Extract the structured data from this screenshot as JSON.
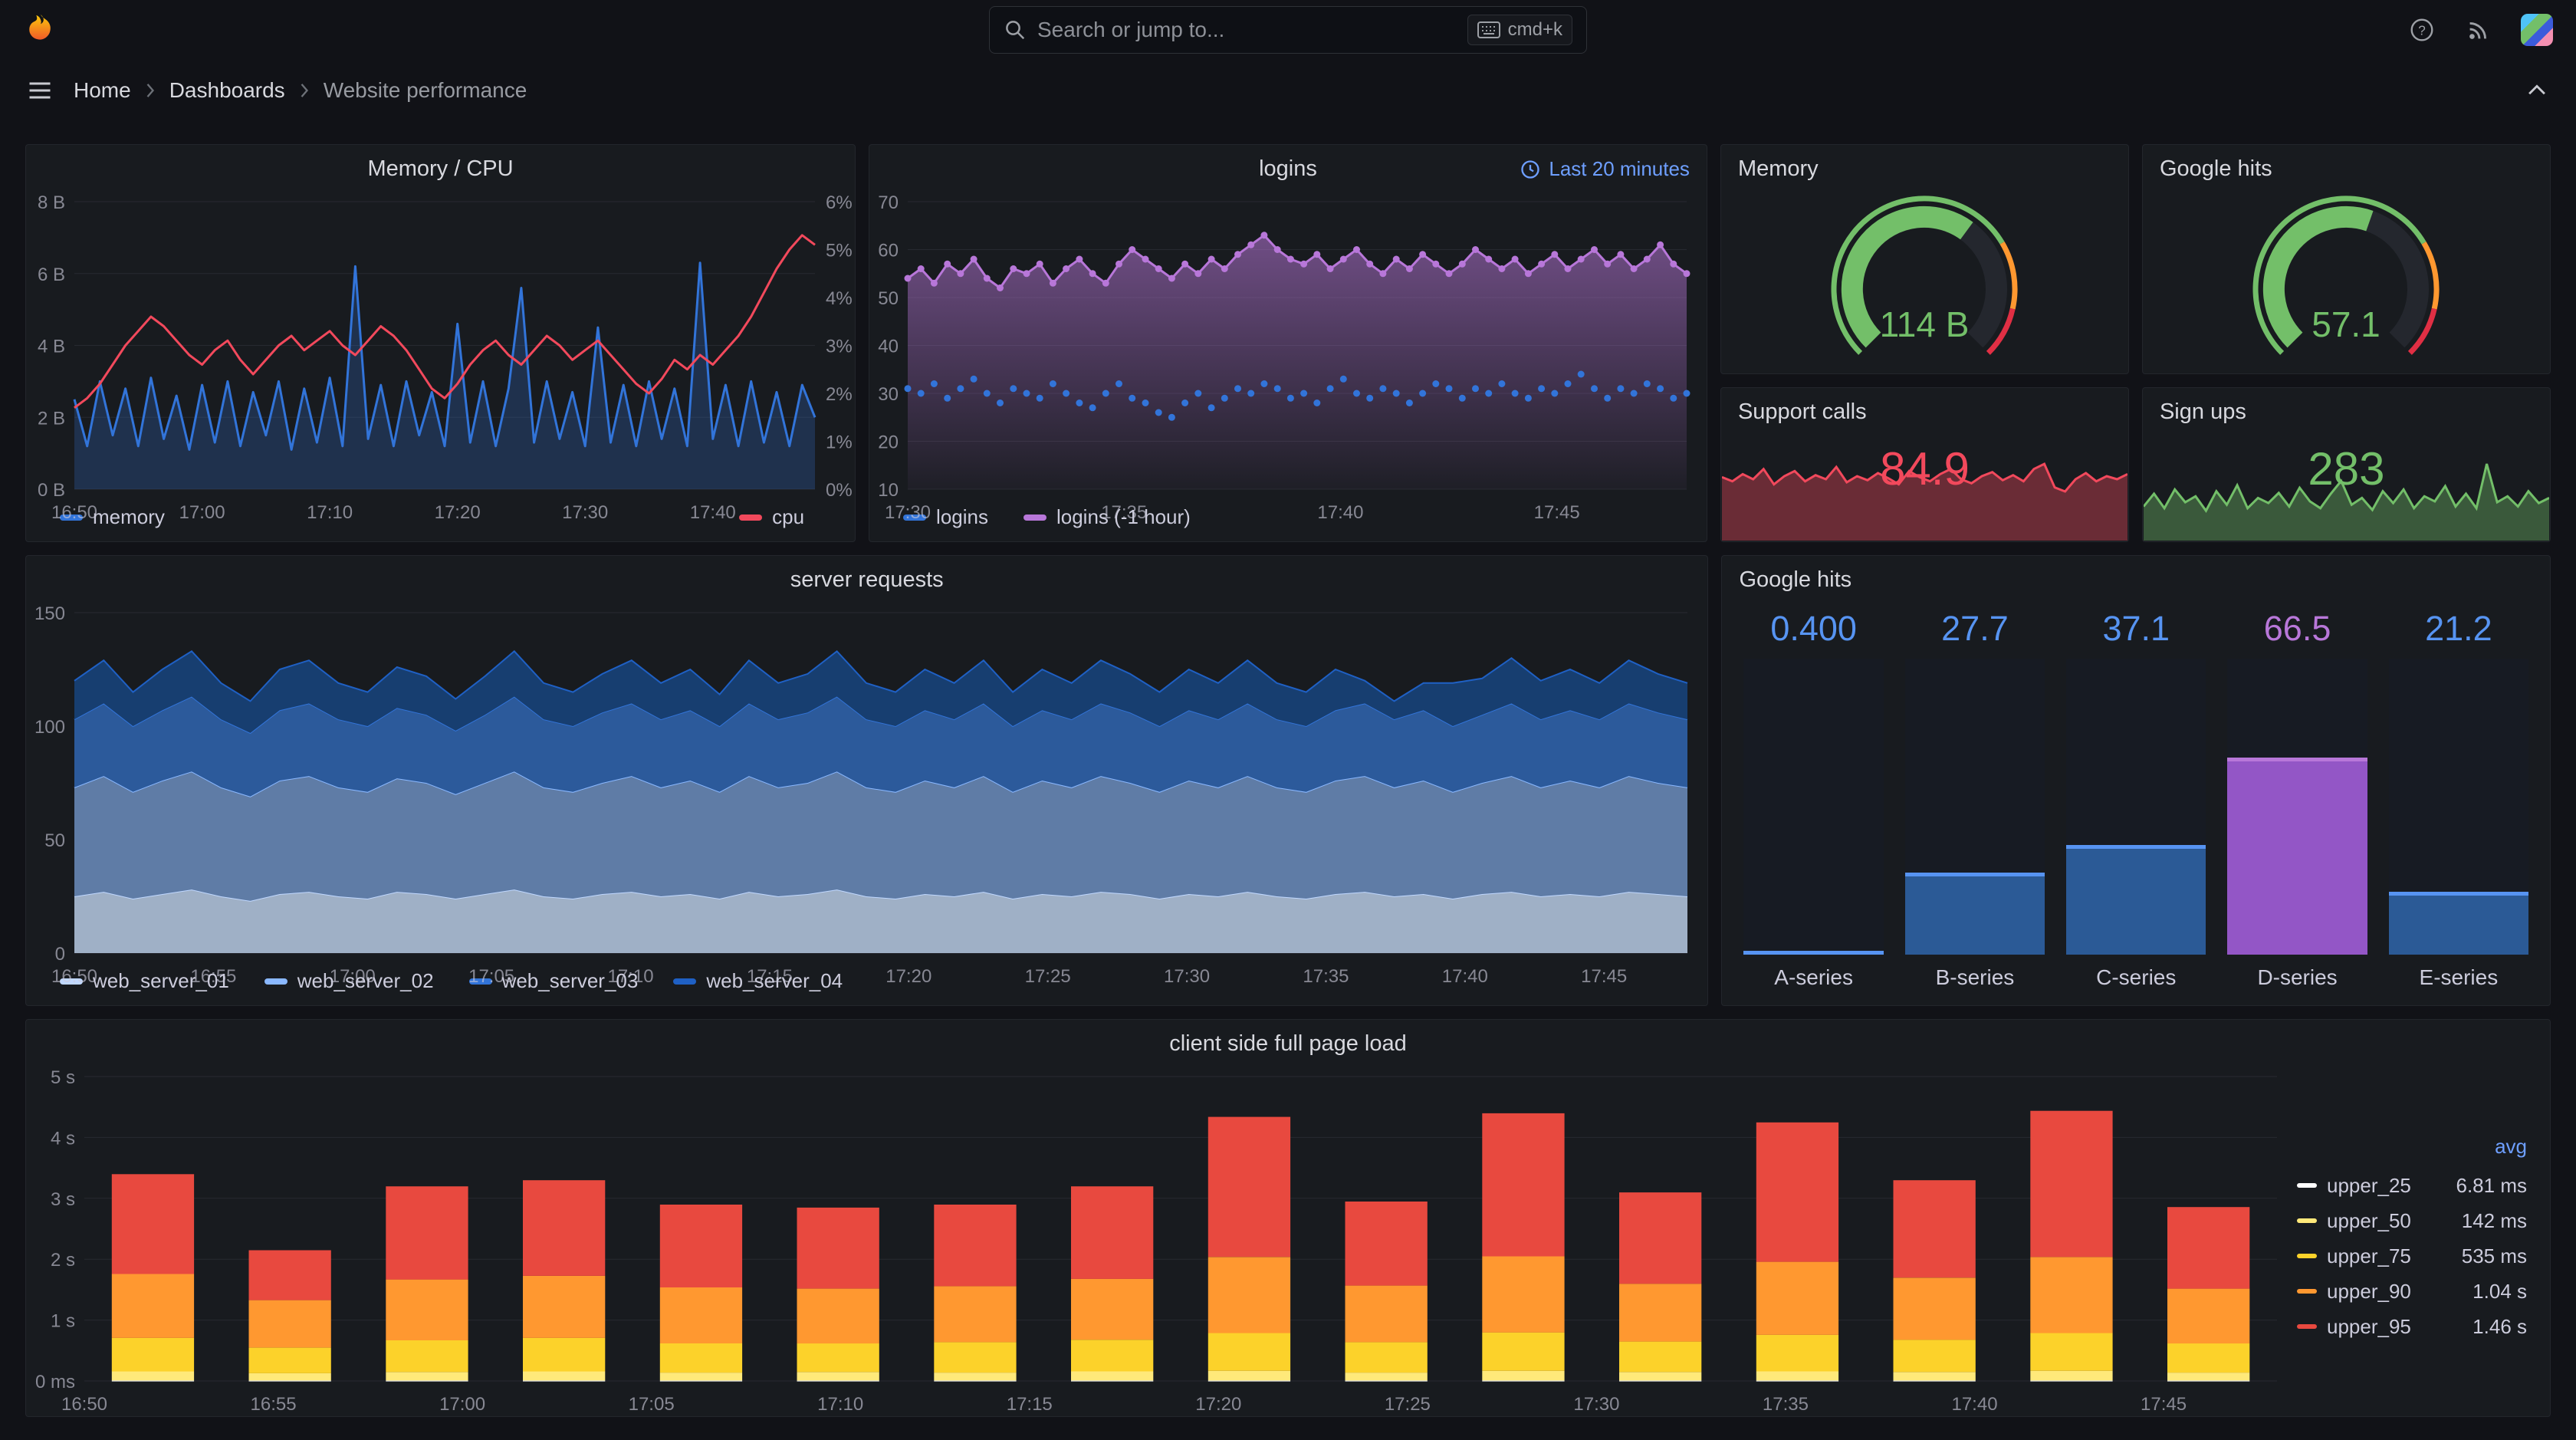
{
  "nav": {
    "search_placeholder": "Search or jump to...",
    "shortcut": "cmd+k"
  },
  "icons": {
    "help": "?"
  },
  "breadcrumb": {
    "items": [
      "Home",
      "Dashboards",
      "Website performance"
    ]
  },
  "colors": {
    "background": "#111217",
    "panel": "#181b1f",
    "blue": "#3274d9",
    "light_blue": "#5794f2",
    "red": "#f2495c",
    "green": "#73bf69",
    "orange": "#ff9830",
    "yellow": "#fcd22a",
    "purple": "#b877d9",
    "link_blue": "#6e9fff"
  },
  "chart_data": [
    {
      "panel": "Memory / CPU",
      "type": "timeseries",
      "x": {
        "domain": 58,
        "ticks": [
          0,
          10,
          20,
          30,
          40,
          50
        ],
        "labels": [
          "16:50",
          "17:00",
          "17:10",
          "17:20",
          "17:30",
          "17:40"
        ]
      },
      "y_left": {
        "min": 0,
        "max": 8,
        "ticks": [
          0,
          2,
          4,
          6,
          8
        ],
        "labels": [
          "0 B",
          "2 B",
          "4 B",
          "6 B",
          "8 B"
        ]
      },
      "y_right": {
        "min": 0,
        "max": 6,
        "ticks": [
          0,
          1,
          2,
          3,
          4,
          5,
          6
        ],
        "labels": [
          "0%",
          "1%",
          "2%",
          "3%",
          "4%",
          "5%",
          "6%"
        ]
      },
      "series": [
        {
          "name": "memory",
          "color": "#3274d9",
          "axis": "left",
          "fill_opacity": 0.25,
          "values": [
            2.5,
            1.2,
            3.0,
            1.5,
            2.8,
            1.2,
            3.1,
            1.4,
            2.6,
            1.1,
            2.9,
            1.3,
            3.0,
            1.2,
            2.7,
            1.5,
            3.0,
            1.1,
            2.8,
            1.3,
            3.1,
            1.2,
            6.2,
            1.4,
            2.9,
            1.2,
            3.0,
            1.5,
            2.7,
            1.2,
            4.6,
            1.3,
            3.0,
            1.2,
            2.8,
            5.6,
            1.3,
            3.0,
            1.4,
            2.7,
            1.2,
            4.5,
            1.3,
            2.9,
            1.2,
            3.0,
            1.4,
            2.8,
            1.2,
            6.3,
            1.4,
            2.9,
            1.2,
            3.0,
            1.3,
            2.7,
            1.2,
            2.9,
            2.0
          ]
        },
        {
          "name": "cpu",
          "color": "#f2495c",
          "axis": "right",
          "values": [
            1.7,
            1.9,
            2.2,
            2.6,
            3.0,
            3.3,
            3.6,
            3.4,
            3.1,
            2.8,
            2.6,
            2.9,
            3.1,
            2.7,
            2.4,
            2.7,
            3.0,
            3.2,
            2.9,
            3.1,
            3.3,
            3.0,
            2.8,
            3.1,
            3.4,
            3.2,
            2.9,
            2.5,
            2.1,
            1.9,
            2.2,
            2.6,
            2.9,
            3.1,
            2.8,
            2.6,
            2.9,
            3.2,
            3.0,
            2.7,
            2.9,
            3.1,
            2.8,
            2.5,
            2.2,
            2.0,
            2.3,
            2.7,
            2.5,
            2.8,
            2.6,
            2.9,
            3.2,
            3.6,
            4.1,
            4.6,
            5.0,
            5.3,
            5.1
          ]
        }
      ]
    },
    {
      "panel": "logins",
      "time_range_label": "Last 20 minutes",
      "type": "timeseries",
      "x": {
        "domain": 18,
        "ticks": [
          0,
          5,
          10,
          15
        ],
        "labels": [
          "17:30",
          "17:35",
          "17:40",
          "17:45"
        ]
      },
      "y_left": {
        "min": 10,
        "max": 70,
        "ticks": [
          10,
          20,
          30,
          40,
          50,
          60,
          70
        ],
        "labels": [
          "10",
          "20",
          "30",
          "40",
          "50",
          "60",
          "70"
        ]
      },
      "series": [
        {
          "name": "logins",
          "color": "#3274d9",
          "style": "points",
          "values": [
            31,
            30,
            32,
            29,
            31,
            33,
            30,
            28,
            31,
            30,
            29,
            32,
            30,
            28,
            27,
            30,
            32,
            29,
            28,
            26,
            25,
            28,
            30,
            27,
            29,
            31,
            30,
            32,
            31,
            29,
            30,
            28,
            31,
            33,
            30,
            29,
            31,
            30,
            28,
            30,
            32,
            31,
            29,
            31,
            30,
            32,
            30,
            29,
            31,
            30,
            32,
            34,
            31,
            29,
            31,
            30,
            32,
            31,
            29,
            30
          ]
        },
        {
          "name": "logins (-1 hour)",
          "color": "#b877d9",
          "style": "line-points",
          "gradient_fill": true,
          "values": [
            54,
            56,
            53,
            57,
            55,
            58,
            54,
            52,
            56,
            55,
            57,
            53,
            56,
            58,
            55,
            53,
            57,
            60,
            58,
            56,
            54,
            57,
            55,
            58,
            56,
            59,
            61,
            63,
            60,
            58,
            57,
            59,
            56,
            58,
            60,
            57,
            55,
            58,
            56,
            59,
            57,
            55,
            57,
            60,
            58,
            56,
            58,
            55,
            57,
            59,
            56,
            58,
            60,
            57,
            59,
            56,
            58,
            61,
            57,
            55
          ]
        }
      ]
    },
    {
      "panel": "Memory",
      "type": "gauge",
      "value": 114,
      "max": 180,
      "display": "114 B",
      "color": "#73bf69",
      "thresholds": [
        {
          "to": 0.72,
          "color": "#73bf69"
        },
        {
          "to": 0.88,
          "color": "#ff9830"
        },
        {
          "to": 1,
          "color": "#e02f44"
        }
      ]
    },
    {
      "panel": "Google hits",
      "type": "gauge",
      "value": 57.1,
      "max": 100,
      "display": "57.1",
      "color": "#73bf69",
      "thresholds": [
        {
          "to": 0.72,
          "color": "#73bf69"
        },
        {
          "to": 0.88,
          "color": "#ff9830"
        },
        {
          "to": 1,
          "color": "#e02f44"
        }
      ]
    },
    {
      "panel": "Support calls",
      "type": "stat",
      "value": "84.9",
      "color": "#f2495c",
      "spark": [
        62,
        58,
        65,
        60,
        70,
        55,
        63,
        68,
        58,
        64,
        60,
        72,
        57,
        63,
        59,
        66,
        61,
        55,
        68,
        62,
        58,
        65,
        70,
        60,
        56,
        63,
        67,
        59,
        64,
        58,
        70,
        75,
        52,
        48,
        60,
        66,
        58,
        63,
        60,
        65
      ]
    },
    {
      "panel": "Sign ups",
      "type": "stat",
      "value": "283",
      "color": "#73bf69",
      "spark": [
        40,
        55,
        38,
        60,
        45,
        52,
        35,
        58,
        42,
        65,
        38,
        50,
        44,
        56,
        40,
        62,
        46,
        38,
        55,
        70,
        42,
        50,
        36,
        58,
        44,
        60,
        38,
        52,
        46,
        64,
        40,
        55,
        38,
        90,
        45,
        52,
        40,
        58,
        44,
        50
      ]
    },
    {
      "panel": "server requests",
      "type": "stacked-area",
      "x": {
        "domain": 58,
        "ticks": [
          0,
          5,
          10,
          15,
          20,
          25,
          30,
          35,
          40,
          45,
          50,
          55
        ],
        "labels": [
          "16:50",
          "16:55",
          "17:00",
          "17:05",
          "17:10",
          "17:15",
          "17:20",
          "17:25",
          "17:30",
          "17:35",
          "17:40",
          "17:45"
        ]
      },
      "y_left": {
        "min": 0,
        "max": 150,
        "ticks": [
          0,
          50,
          100,
          150
        ],
        "labels": [
          "0",
          "50",
          "100",
          "150"
        ]
      },
      "series": [
        {
          "name": "web_server_01",
          "color": "#c0d8ff",
          "fill": "#9fb0c6",
          "values": [
            25,
            27,
            24,
            26,
            28,
            25,
            23,
            26,
            27,
            25,
            24,
            27,
            26,
            24,
            26,
            28,
            25,
            24,
            26,
            27,
            25,
            26,
            24,
            27,
            25,
            26,
            28,
            25,
            24,
            26,
            25,
            27,
            24,
            26,
            25,
            27,
            26,
            24,
            26,
            25,
            27,
            25,
            24,
            26,
            27,
            25,
            26,
            24,
            26,
            27,
            25,
            26,
            25,
            27,
            26,
            25
          ]
        },
        {
          "name": "web_server_02",
          "color": "#8ab8ff",
          "fill": "#5f7ca6",
          "values": [
            48,
            51,
            47,
            50,
            52,
            48,
            46,
            50,
            51,
            48,
            47,
            50,
            49,
            46,
            49,
            52,
            48,
            47,
            49,
            51,
            48,
            50,
            47,
            51,
            48,
            49,
            52,
            48,
            47,
            50,
            48,
            51,
            47,
            50,
            48,
            51,
            49,
            47,
            50,
            48,
            51,
            48,
            47,
            50,
            51,
            48,
            50,
            47,
            49,
            51,
            48,
            50,
            48,
            51,
            49,
            48
          ]
        },
        {
          "name": "web_server_03",
          "color": "#3274d9",
          "fill": "#2c5a9b",
          "values": [
            30,
            32,
            29,
            31,
            33,
            30,
            28,
            31,
            32,
            30,
            29,
            31,
            30,
            28,
            30,
            33,
            30,
            29,
            31,
            32,
            30,
            31,
            29,
            32,
            30,
            31,
            33,
            30,
            29,
            31,
            30,
            32,
            29,
            31,
            30,
            32,
            31,
            29,
            31,
            30,
            32,
            30,
            29,
            31,
            32,
            30,
            31,
            29,
            30,
            32,
            30,
            31,
            30,
            32,
            31,
            30
          ]
        },
        {
          "name": "web_server_04",
          "color": "#1f60c4",
          "fill": "#173e70",
          "values": [
            17,
            19,
            15,
            18,
            20,
            16,
            14,
            18,
            19,
            16,
            15,
            18,
            17,
            14,
            17,
            20,
            16,
            15,
            17,
            19,
            16,
            18,
            14,
            19,
            16,
            17,
            20,
            16,
            15,
            18,
            16,
            19,
            15,
            18,
            16,
            19,
            17,
            15,
            18,
            16,
            19,
            16,
            15,
            18,
            10,
            8,
            12,
            19,
            16,
            20,
            17,
            18,
            16,
            19,
            17,
            16
          ]
        }
      ]
    },
    {
      "panel": "Google hits",
      "type": "bar-gauge",
      "max": 100,
      "bars": [
        {
          "label": "A-series",
          "display": "0.400",
          "value": 0.4,
          "color": "#5794f2",
          "fill": "#2b5a96"
        },
        {
          "label": "B-series",
          "display": "27.7",
          "value": 27.7,
          "color": "#5794f2",
          "fill": "#2b5a96"
        },
        {
          "label": "C-series",
          "display": "37.1",
          "value": 37.1,
          "color": "#5794f2",
          "fill": "#2b5a96"
        },
        {
          "label": "D-series",
          "display": "66.5",
          "value": 66.5,
          "color": "#b877d9",
          "fill": "#9356c6"
        },
        {
          "label": "E-series",
          "display": "21.2",
          "value": 21.2,
          "color": "#5794f2",
          "fill": "#2b5a96"
        }
      ]
    },
    {
      "panel": "client side full page load",
      "type": "stacked-bars",
      "legend_header": "avg",
      "x": {
        "domain": 58,
        "ticks": [
          0,
          5,
          10,
          15,
          20,
          25,
          30,
          35,
          40,
          45,
          50,
          55
        ],
        "labels": [
          "16:50",
          "16:55",
          "17:00",
          "17:05",
          "17:10",
          "17:15",
          "17:20",
          "17:25",
          "17:30",
          "17:35",
          "17:40",
          "17:45"
        ]
      },
      "y_left": {
        "min": 0,
        "max": 5,
        "ticks": [
          0,
          1,
          2,
          3,
          4,
          5
        ],
        "labels": [
          "0 ms",
          "1 s",
          "2 s",
          "3 s",
          "4 s",
          "5 s"
        ]
      },
      "series": [
        {
          "name": "upper_25",
          "avg": "6.81 ms",
          "color": "#ffffff",
          "values": [
            0.007,
            0.007,
            0.007,
            0.007,
            0.007,
            0.007,
            0.007,
            0.007,
            0.007,
            0.007,
            0.007,
            0.007,
            0.007,
            0.007,
            0.007,
            0.007
          ]
        },
        {
          "name": "upper_50",
          "avg": "142 ms",
          "color": "#ffe97a",
          "values": [
            0.15,
            0.12,
            0.14,
            0.15,
            0.13,
            0.14,
            0.13,
            0.15,
            0.16,
            0.13,
            0.16,
            0.14,
            0.15,
            0.14,
            0.16,
            0.13
          ]
        },
        {
          "name": "upper_75",
          "avg": "535 ms",
          "color": "#fcd22a",
          "values": [
            0.55,
            0.42,
            0.52,
            0.55,
            0.48,
            0.47,
            0.5,
            0.52,
            0.62,
            0.5,
            0.63,
            0.5,
            0.6,
            0.53,
            0.62,
            0.48
          ]
        },
        {
          "name": "upper_90",
          "avg": "1.04 s",
          "color": "#ff9830",
          "values": [
            1.05,
            0.78,
            1.0,
            1.02,
            0.92,
            0.9,
            0.92,
            1.0,
            1.25,
            0.93,
            1.25,
            0.95,
            1.2,
            1.02,
            1.25,
            0.9
          ]
        },
        {
          "name": "upper_95",
          "avg": "1.46 s",
          "color": "#e8493f",
          "values": [
            1.64,
            0.82,
            1.53,
            1.57,
            1.36,
            1.33,
            1.34,
            1.52,
            2.3,
            1.38,
            2.35,
            1.5,
            2.29,
            1.6,
            2.4,
            1.34
          ]
        }
      ]
    }
  ]
}
